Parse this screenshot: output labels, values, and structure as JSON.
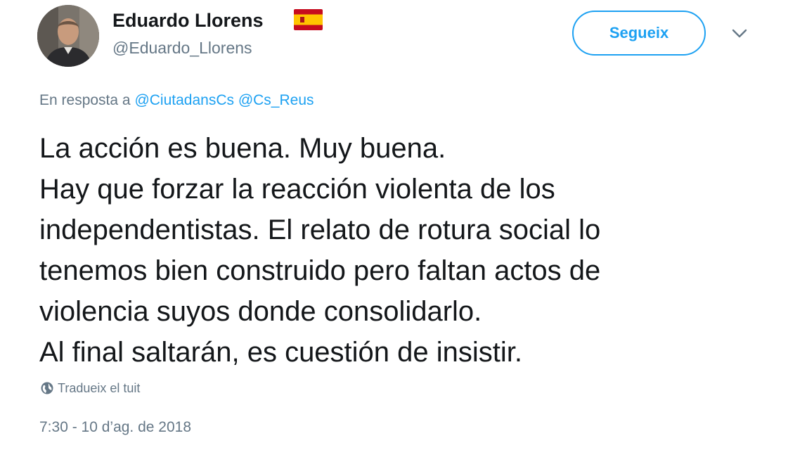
{
  "header": {
    "display_name": "Eduardo Llorens",
    "flag_icon": "spain-flag-icon",
    "handle": "@Eduardo_Llorens",
    "follow_label": "Segueix",
    "menu_icon": "chevron-down-icon"
  },
  "reply": {
    "prefix": "En resposta a",
    "mentions": [
      "@CiutadansCs",
      "@Cs_Reus"
    ]
  },
  "tweet": {
    "lines": [
      "La acción es buena. Muy buena.",
      "Hay que forzar la reacción violenta de los",
      "independentistas. El relato de rotura social lo",
      "tenemos bien construido pero faltan actos de",
      "violencia suyos donde consolidarlo.",
      "Al final saltarán, es cuestión de insistir."
    ]
  },
  "translate": {
    "icon": "globe-icon",
    "label": "Tradueix el tuit"
  },
  "timestamp": "7:30 - 10 d’ag. de 2018",
  "colors": {
    "accent": "#1da1f2",
    "muted": "#657786",
    "text": "#14171a"
  }
}
